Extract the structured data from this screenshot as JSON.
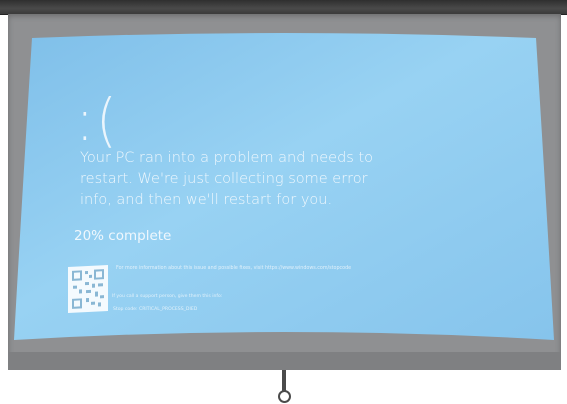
{
  "bsod": {
    "face": ":(",
    "message": "Your PC ran into a problem and needs to restart. We're just collecting some error info, and then we'll restart for you.",
    "progress": "20% complete",
    "more_info": "For more information about this issue and possible fixes, visit https://www.windows.com/stopcode",
    "support": "If you call a support person, give them this info:",
    "stop_code": "Stop code: CRITICAL_PROCESS_DIED"
  },
  "colors": {
    "bsod_blue": "#8ecbf0",
    "screen_grey": "#8f9092",
    "roller": "#3a3a3a"
  },
  "icons": {
    "qr": "qr-code-icon",
    "pull_ring": "pull-ring-icon"
  }
}
